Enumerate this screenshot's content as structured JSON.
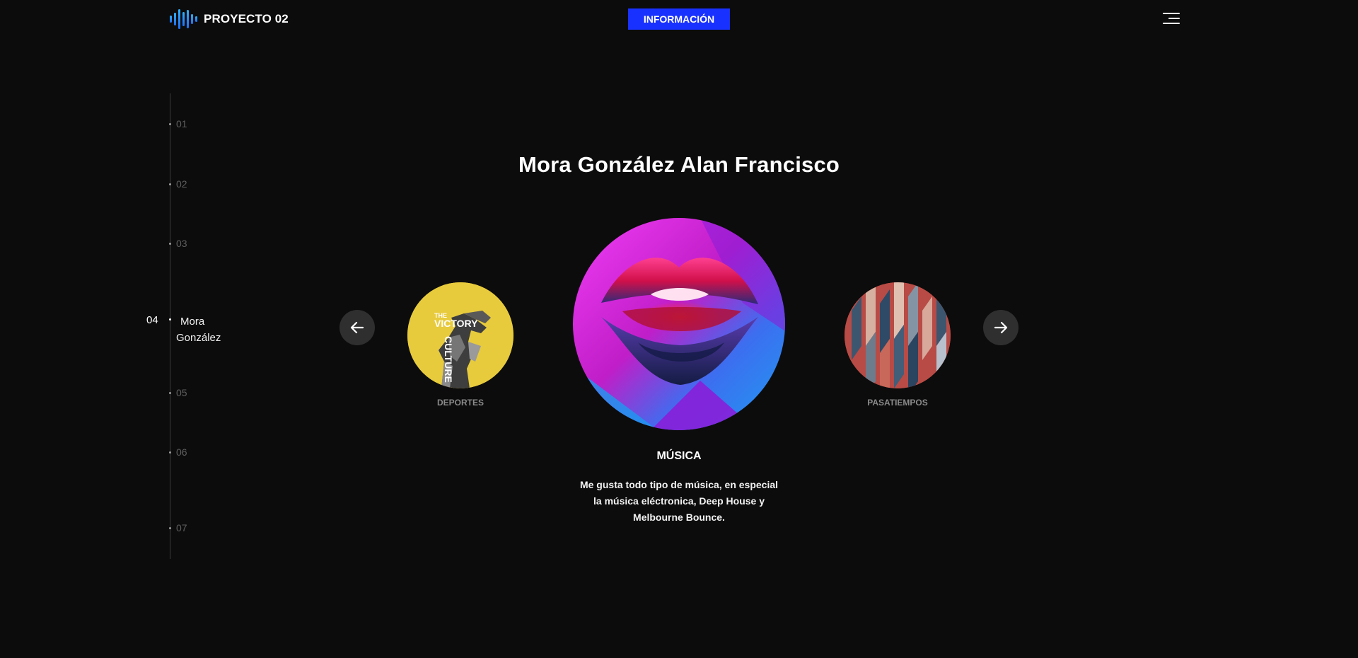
{
  "header": {
    "logo_text": "PROYECTO 02",
    "info_button": "INFORMACIÓN",
    "accent_color": "#1931ff"
  },
  "sidenav": {
    "items": [
      {
        "number": "01"
      },
      {
        "number": "02"
      },
      {
        "number": "03"
      },
      {
        "number": "04",
        "label": "Mora González",
        "active": true
      },
      {
        "number": "05"
      },
      {
        "number": "06"
      },
      {
        "number": "07"
      }
    ]
  },
  "main": {
    "title": "Mora González Alan Francisco",
    "cards": {
      "left": {
        "label": "DEPORTES",
        "image_text_a": "THE",
        "image_text_b": "VICTORY",
        "image_text_c": "CULTURE"
      },
      "center": {
        "label": "MÚSICA"
      },
      "right": {
        "label": "PASATIEMPOS"
      }
    },
    "description": "Me gusta todo tipo de música, en especial la música eléctronica, Deep House y Melbourne Bounce."
  },
  "icons": {
    "logo": "sound-wave-icon",
    "menu": "hamburger-menu-icon",
    "prev": "arrow-left-icon",
    "next": "arrow-right-icon"
  }
}
